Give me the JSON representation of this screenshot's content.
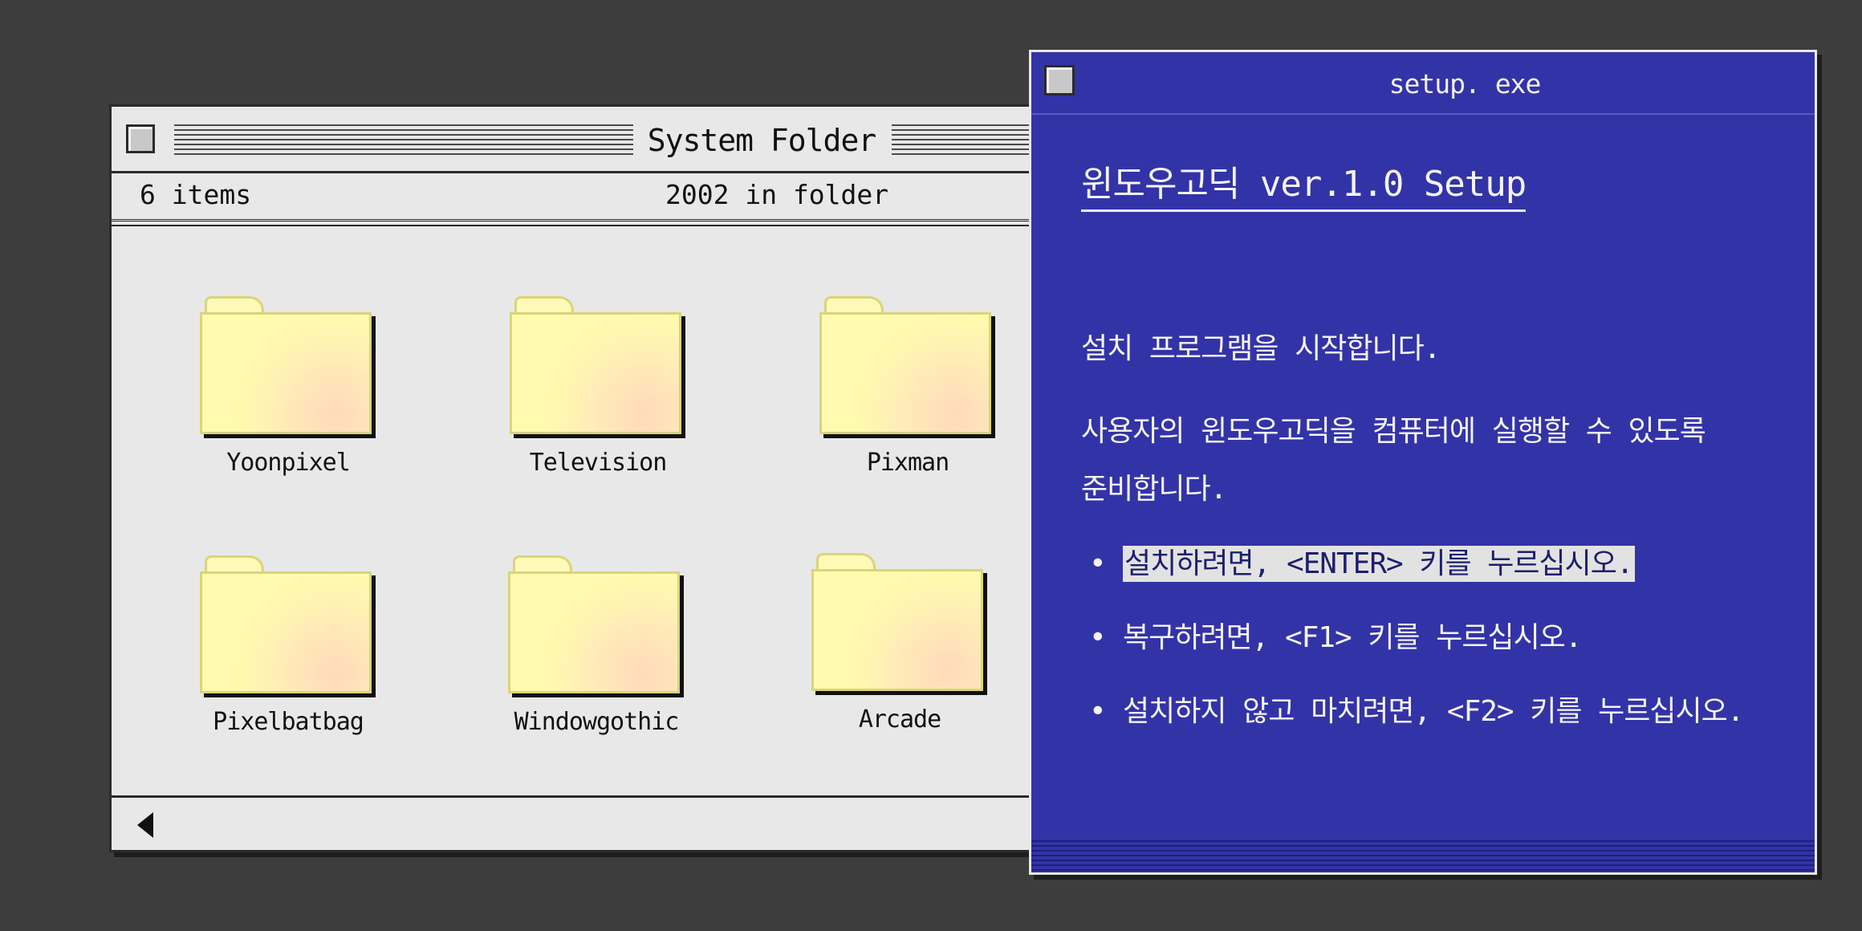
{
  "finder": {
    "title": "System Folder",
    "items_count": "6 items",
    "folder_info": "2002 in folder",
    "folders": [
      {
        "name": "Yoonpixel"
      },
      {
        "name": "Television"
      },
      {
        "name": "Pixman"
      },
      {
        "name": "Pixelbatbag"
      },
      {
        "name": "Windowgothic"
      },
      {
        "name": "Arcade"
      }
    ]
  },
  "setup": {
    "title": "setup. exe",
    "heading": "윈도우고딕 ver.1.0 Setup",
    "intro": "설치 프로그램을 시작합니다.",
    "desc_line1": "사용자의 윈도우고딕을 컴퓨터에 실행할 수 있도록",
    "desc_line2": "준비합니다.",
    "bullet_mark": "•",
    "options": [
      {
        "text": "설치하려면, <ENTER> 키를 누르십시오.",
        "selected": true
      },
      {
        "text": "복구하려면, <F1> 키를 누르십시오.",
        "selected": false
      },
      {
        "text": "설치하지 않고 마치려면, <F2> 키를 누르십시오.",
        "selected": false
      }
    ]
  },
  "colors": {
    "desktop": "#3d3d3d",
    "setup_blue": "#3333a8",
    "folder_yellow": "#fffaae",
    "window_gray": "#e8e8e8"
  },
  "icons": {
    "folder": "folder-icon",
    "close": "close-box-icon",
    "scroll_left": "arrow-left-icon"
  }
}
